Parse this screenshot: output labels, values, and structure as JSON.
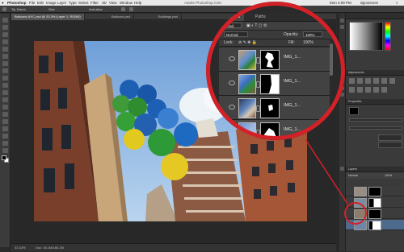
{
  "menubar": {
    "items": [
      "Photoshop",
      "File",
      "Edit",
      "Image",
      "Layer",
      "Type",
      "Select",
      "Filter",
      "3D",
      "View",
      "Window",
      "Help"
    ],
    "clock": "Mon 4:09 PM",
    "user": "dgrossmen"
  },
  "window_title": "Adobe Photoshop CS6",
  "options_bar": {
    "items": [
      "Tip Select",
      "Size",
      "Anti-alias"
    ]
  },
  "document_tabs": [
    "Balloons-NYC.psd @ 33.3% (Layer 1, RGB/8)",
    "Balloons.psd",
    "Buildings.psd"
  ],
  "layers_panel": {
    "tabs": [
      "Layers",
      "Paths"
    ],
    "kind_label": "Kind",
    "blend_mode": "Normal",
    "opacity_label": "Opacity:",
    "opacity_value": "100%",
    "lock_label": "Lock:",
    "fill_label": "Fill:",
    "fill_value": "100%",
    "layers": [
      {
        "name": "IMG_1..."
      },
      {
        "name": "IMG_1..."
      },
      {
        "name": "IMG_1..."
      },
      {
        "name": "IMG_1..."
      }
    ]
  },
  "status_bar": {
    "zoom": "33.33%",
    "doc": "Doc: 45.1M/180.2M"
  },
  "right_panels": {
    "adjustments_title": "Adjustments",
    "properties_title": "Properties",
    "layers_mini_title": "Layers",
    "layers_mini_mode": "Normal",
    "layers_mini_opacity": "100%"
  },
  "colors": {
    "highlight": "#d32127",
    "selected_row": "#4e6a8c",
    "sky": "#8fb9e6"
  }
}
